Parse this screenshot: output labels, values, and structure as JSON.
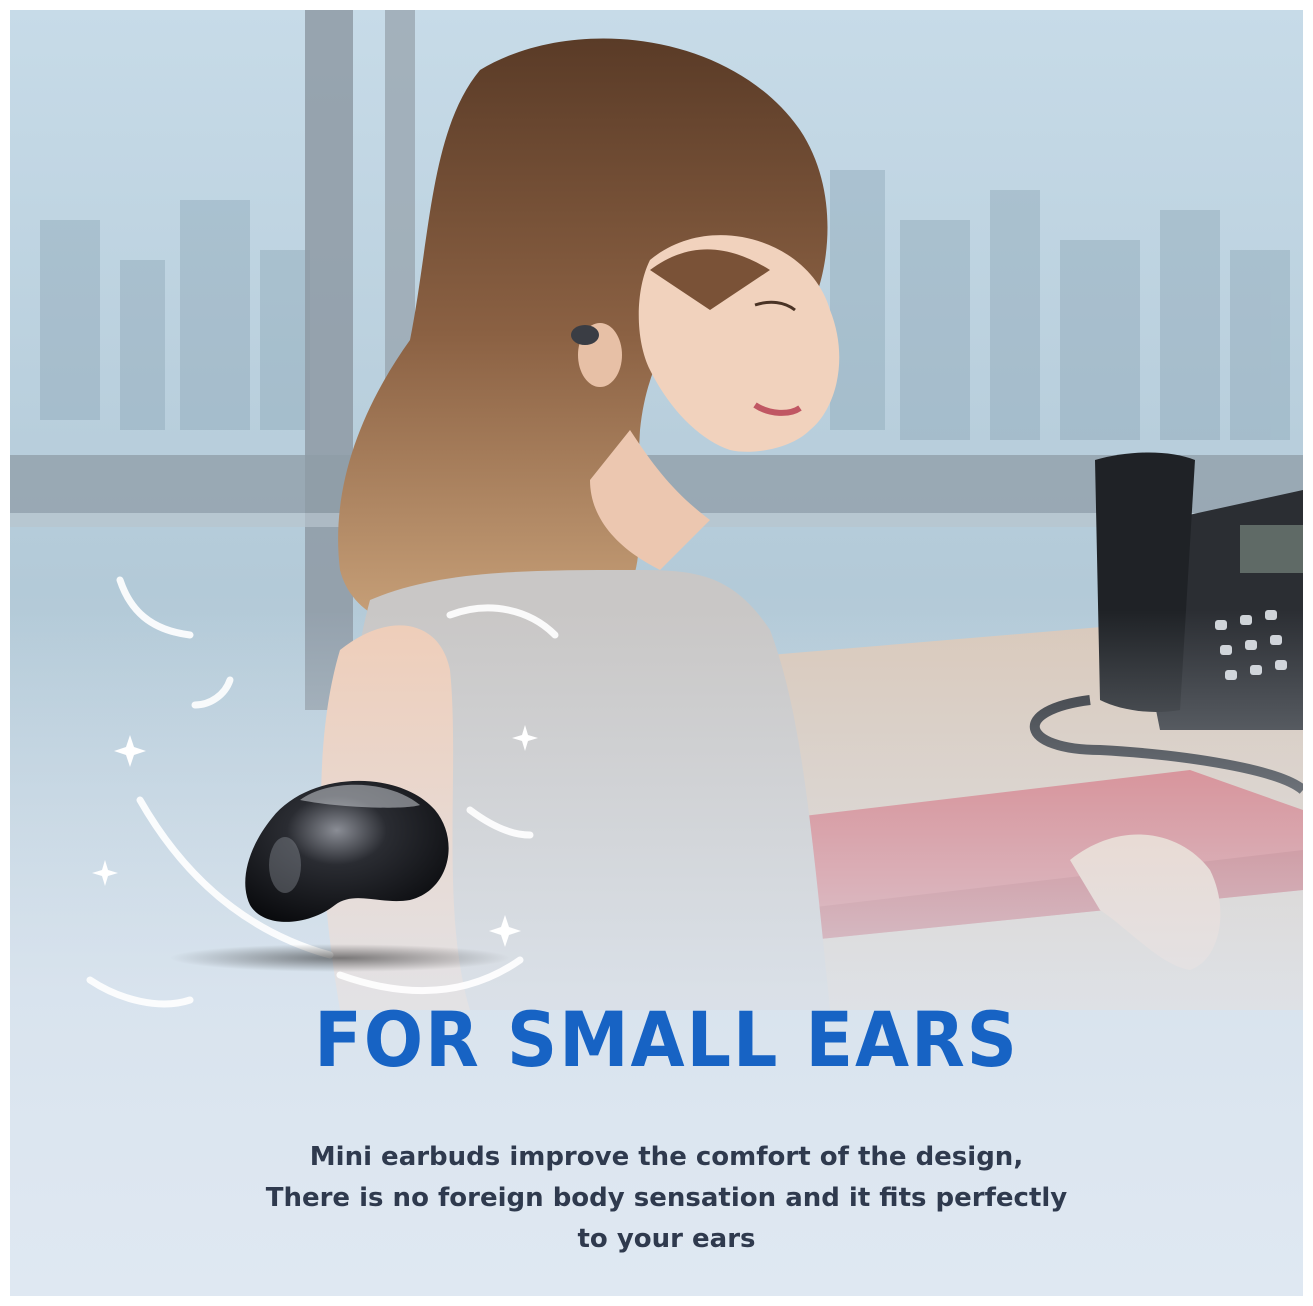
{
  "headline": "FOR SMALL EARS",
  "caption": {
    "line1": "Mini earbuds improve the comfort of the design,",
    "line2": "There is no foreign body sensation and it fits perfectly",
    "line3": "to your ears"
  },
  "colors": {
    "headline": "#1763c4",
    "caption": "#2f3a4e",
    "background_fade": "#dfe8f2"
  },
  "icons": [
    "earbud-icon",
    "feather-icon",
    "sparkle-icon",
    "desk-phone-icon"
  ]
}
